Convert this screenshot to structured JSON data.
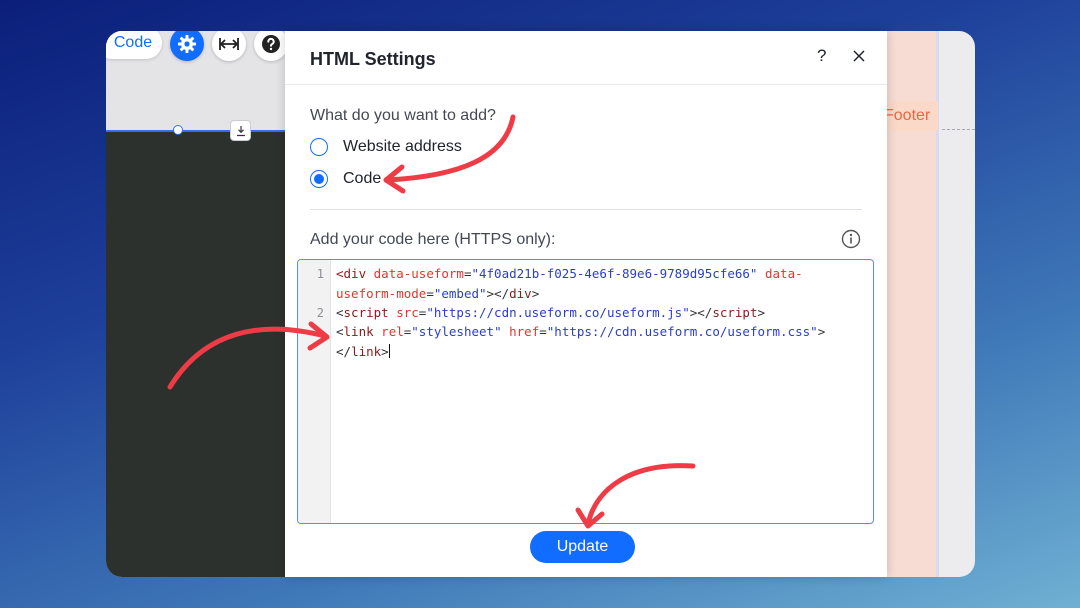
{
  "editor_bg": {
    "code_button_label": "Code",
    "footer_tag": "Footer",
    "icons": [
      "gear-icon",
      "stretch-icon",
      "help-icon",
      "download-icon"
    ]
  },
  "dialog": {
    "title": "HTML Settings",
    "help_label": "?",
    "question": "What do you want to add?",
    "options": [
      {
        "label": "Website address",
        "selected": false
      },
      {
        "label": "Code",
        "selected": true
      }
    ],
    "code_label": "Add your code here (HTTPS only):",
    "gutter_numbers": [
      "1",
      "2"
    ],
    "update_label": "Update"
  },
  "colors": {
    "accent": "#116dff",
    "annotation_arrow": "#ef3b46",
    "footer_text": "#f0643f"
  },
  "code_tokens": {
    "line1a": [
      {
        "t": "<",
        "c": "tg"
      },
      {
        "t": "div",
        "c": "tg"
      },
      {
        "t": " "
      },
      {
        "t": "data-useform",
        "c": "at"
      },
      {
        "t": "="
      },
      {
        "t": "\"4f0ad21b-f025-4e6f-89e6-9789d95cfe66\"",
        "c": "vl"
      },
      {
        "t": " "
      },
      {
        "t": "data-",
        "c": "at"
      }
    ],
    "line1b": [
      {
        "t": "useform-mode",
        "c": "at"
      },
      {
        "t": "="
      },
      {
        "t": "\"embed\"",
        "c": "vl"
      },
      {
        "t": "></"
      },
      {
        "t": "div",
        "c": "tg"
      },
      {
        "t": ">"
      }
    ],
    "line2": [
      {
        "t": "<"
      },
      {
        "t": "script",
        "c": "tg"
      },
      {
        "t": " "
      },
      {
        "t": "src",
        "c": "at"
      },
      {
        "t": "="
      },
      {
        "t": "\"https://cdn.useform.co/useform.js\"",
        "c": "vl"
      },
      {
        "t": "></"
      },
      {
        "t": "script",
        "c": "tg"
      },
      {
        "t": ">"
      }
    ],
    "line3": [
      {
        "t": "<"
      },
      {
        "t": "link",
        "c": "tg"
      },
      {
        "t": " "
      },
      {
        "t": "rel",
        "c": "at"
      },
      {
        "t": "="
      },
      {
        "t": "\"stylesheet\"",
        "c": "vl"
      },
      {
        "t": " "
      },
      {
        "t": "href",
        "c": "at"
      },
      {
        "t": "="
      },
      {
        "t": "\"https://cdn.useform.co/useform.css\"",
        "c": "vl"
      },
      {
        "t": ">"
      }
    ],
    "line4": [
      {
        "t": "</"
      },
      {
        "t": "link",
        "c": "tg"
      },
      {
        "t": ">"
      }
    ]
  }
}
